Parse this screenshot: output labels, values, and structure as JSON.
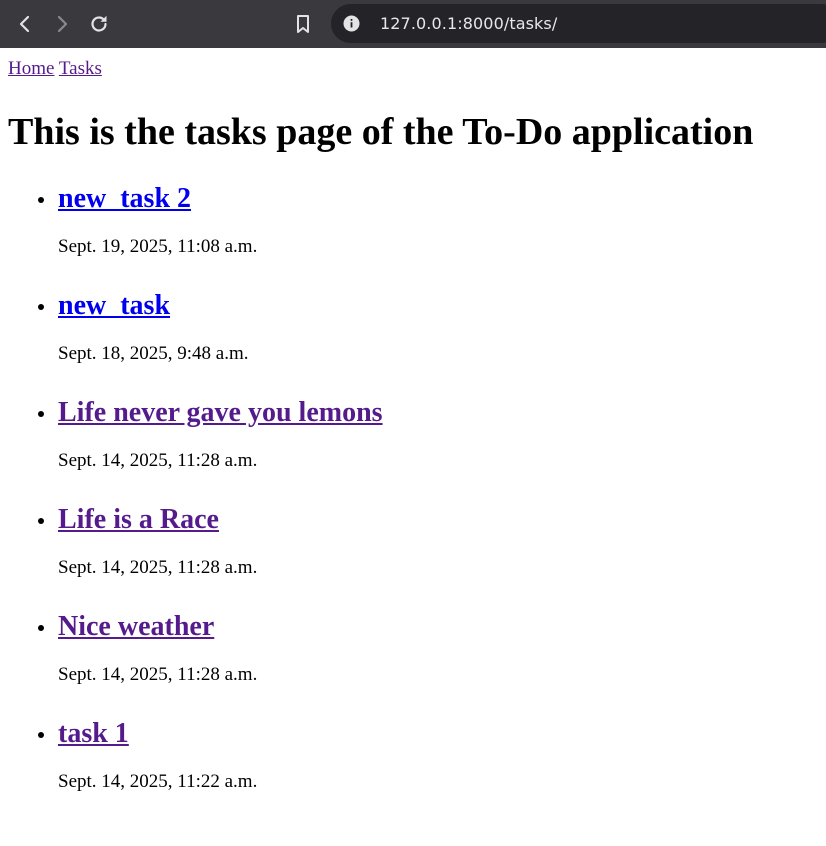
{
  "browser": {
    "url": "127.0.0.1:8000/tasks/",
    "icons": [
      "back-arrow-icon",
      "forward-arrow-icon",
      "reload-icon",
      "bookmark-icon",
      "info-icon"
    ]
  },
  "nav": {
    "home_label": "Home",
    "tasks_label": "Tasks"
  },
  "page": {
    "title": "This is the tasks page of the To-Do application"
  },
  "tasks": [
    {
      "title": "new_task 2",
      "date": "Sept. 19, 2025, 11:08 a.m.",
      "visited": false
    },
    {
      "title": "new_task",
      "date": "Sept. 18, 2025, 9:48 a.m.",
      "visited": false
    },
    {
      "title": "Life never gave you lemons",
      "date": "Sept. 14, 2025, 11:28 a.m.",
      "visited": true
    },
    {
      "title": "Life is a Race",
      "date": "Sept. 14, 2025, 11:28 a.m.",
      "visited": true
    },
    {
      "title": "Nice weather",
      "date": "Sept. 14, 2025, 11:28 a.m.",
      "visited": true
    },
    {
      "title": "task 1",
      "date": "Sept. 14, 2025, 11:22 a.m.",
      "visited": true
    }
  ],
  "colors": {
    "browser_bar": "#3a393e",
    "omnibox": "#242327",
    "link_unvisited": "#0000ee",
    "link_visited": "#551a8b"
  }
}
